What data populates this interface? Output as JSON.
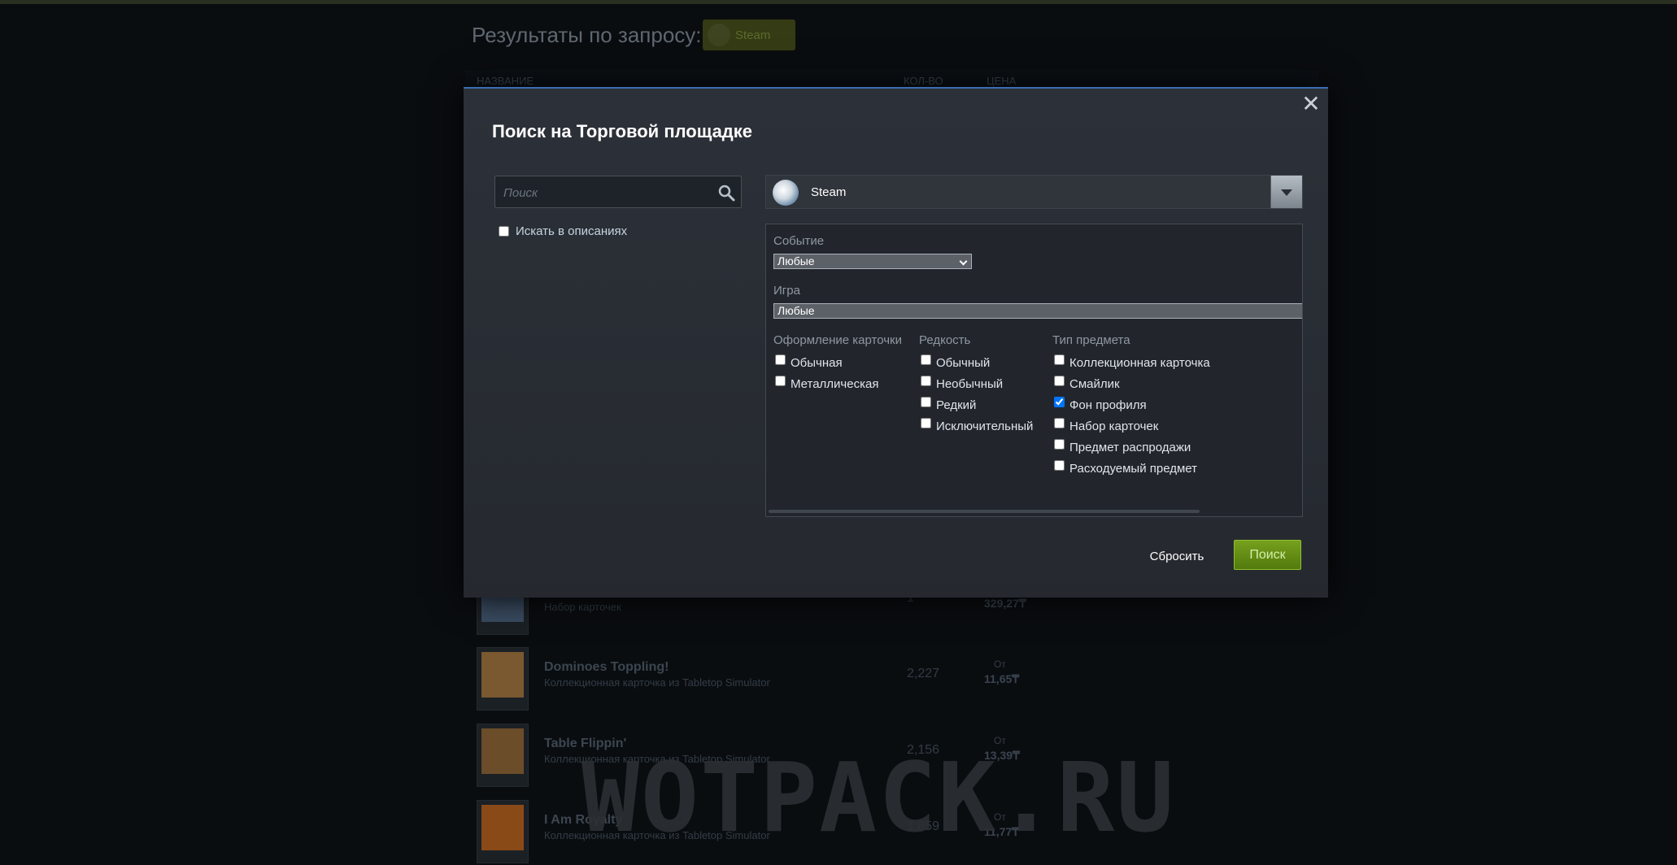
{
  "background": {
    "title": "Результаты по запросу:",
    "tag_label": "Steam",
    "columns": [
      "НАЗВАНИЕ",
      "КОЛ-ВО",
      "ЦЕНА"
    ],
    "rows": [
      {
        "name": "",
        "desc": "Набор карточек",
        "qty": "1",
        "from": "",
        "price": "329,27₸",
        "color": "#3b4d63"
      },
      {
        "name": "Dominoes Toppling!",
        "desc": "Коллекционная карточка из Tabletop Simulator",
        "qty": "2,227",
        "from": "От",
        "price": "11,65₸",
        "color": "#7a5830"
      },
      {
        "name": "Table Flippin'",
        "desc": "Коллекционная карточка из Tabletop Simulator",
        "qty": "2,156",
        "from": "От",
        "price": "13,39₸",
        "color": "#6b4d2a"
      },
      {
        "name": "I Am Royalty",
        "desc": "Коллекционная карточка из Tabletop Simulator",
        "qty": "1,859",
        "from": "От",
        "price": "11,77₸",
        "color": "#8a4a18"
      }
    ],
    "watermark": "WOTPACK.RU"
  },
  "modal": {
    "title": "Поиск на Торговой площадке",
    "close_label": "✕",
    "search": {
      "placeholder": "Поиск",
      "value": ""
    },
    "search_descriptions_label": "Искать в описаниях",
    "app": {
      "name": "Steam"
    },
    "event": {
      "label": "Событие",
      "value": "Любые"
    },
    "game": {
      "label": "Игра",
      "value": "Любые"
    },
    "card_border": {
      "label": "Оформление карточки",
      "options": [
        {
          "label": "Обычная",
          "checked": false
        },
        {
          "label": "Металлическая",
          "checked": false
        }
      ]
    },
    "rarity": {
      "label": "Редкость",
      "options": [
        {
          "label": "Обычный",
          "checked": false
        },
        {
          "label": "Необычный",
          "checked": false
        },
        {
          "label": "Редкий",
          "checked": false
        },
        {
          "label": "Исключительный",
          "checked": false
        }
      ]
    },
    "item_type": {
      "label": "Тип предмета",
      "options": [
        {
          "label": "Коллекционная карточка",
          "checked": false
        },
        {
          "label": "Смайлик",
          "checked": false
        },
        {
          "label": "Фон профиля",
          "checked": true
        },
        {
          "label": "Набор карточек",
          "checked": false
        },
        {
          "label": "Предмет распродажи",
          "checked": false
        },
        {
          "label": "Расходуемый предмет",
          "checked": false
        }
      ]
    },
    "reset_label": "Сбросить",
    "search_label": "Поиск"
  },
  "colors": {
    "accent_green": "#76a01c",
    "accent_blue": "#3b6db1"
  }
}
